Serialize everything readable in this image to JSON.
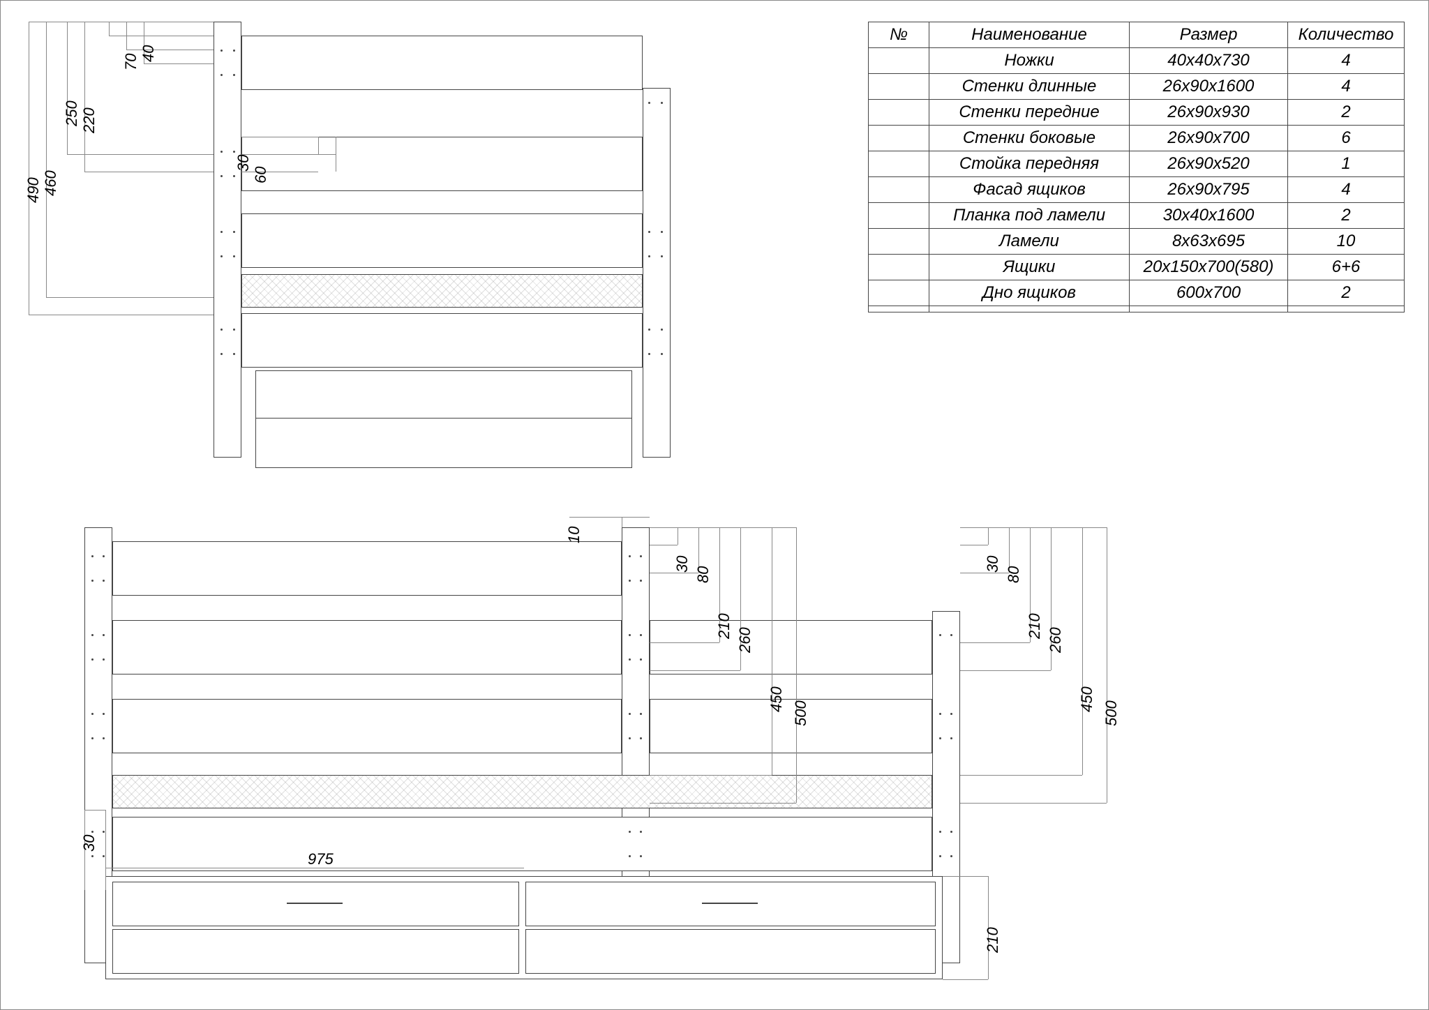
{
  "table": {
    "headers": {
      "num": "№",
      "name": "Наименование",
      "size": "Размер",
      "qty": "Количество"
    },
    "rows": [
      {
        "num": "",
        "name": "Ножки",
        "size": "40х40х730",
        "qty": "4"
      },
      {
        "num": "",
        "name": "Стенки длинные",
        "size": "26х90х1600",
        "qty": "4"
      },
      {
        "num": "",
        "name": "Стенки передние",
        "size": "26х90х930",
        "qty": "2"
      },
      {
        "num": "",
        "name": "Стенки боковые",
        "size": "26х90х700",
        "qty": "6"
      },
      {
        "num": "",
        "name": "Стойка передняя",
        "size": "26х90х520",
        "qty": "1"
      },
      {
        "num": "",
        "name": "Фасад ящиков",
        "size": "26х90х795",
        "qty": "4"
      },
      {
        "num": "",
        "name": "Планка под ламели",
        "size": "30х40х1600",
        "qty": "2"
      },
      {
        "num": "",
        "name": "Ламели",
        "size": "8х63х695",
        "qty": "10"
      },
      {
        "num": "",
        "name": "Ящики",
        "size": "20х150х700(580)",
        "qty": "6+6"
      },
      {
        "num": "",
        "name": "Дно ящиков",
        "size": "600х700",
        "qty": "2"
      },
      {
        "num": "",
        "name": "",
        "size": "",
        "qty": ""
      }
    ]
  },
  "dims_top": {
    "d490": "490",
    "d460": "460",
    "d250": "250",
    "d220": "220",
    "d70": "70",
    "d40": "40",
    "d30": "30",
    "d60": "60"
  },
  "dims_front": {
    "d10": "10",
    "d30a": "30",
    "d80a": "80",
    "d210a": "210",
    "d260a": "260",
    "d450a": "450",
    "d500a": "500",
    "d30b": "30",
    "d80b": "80",
    "d210b": "210",
    "d260b": "260",
    "d450b": "450",
    "d500b": "500",
    "d30c": "30",
    "d975": "975",
    "d210c": "210"
  }
}
